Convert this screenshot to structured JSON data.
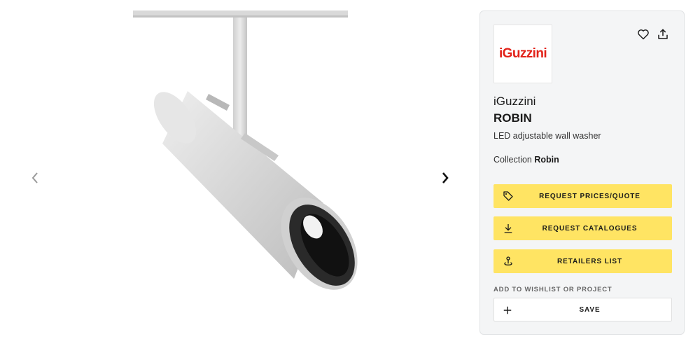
{
  "gallery": {
    "image_alt": "iGuzzini ROBIN LED adjustable wall washer",
    "prev_icon": "chevron-left-icon",
    "next_icon": "chevron-right-icon"
  },
  "card": {
    "logo_text": "iGuzzini",
    "wishlist_icon": "heart-icon",
    "share_icon": "share-icon",
    "brand": "iGuzzini",
    "product_name": "ROBIN",
    "description": "LED adjustable wall washer",
    "collection_label": "Collection",
    "collection_value": "Robin",
    "actions": {
      "quote": {
        "label": "REQUEST PRICES/QUOTE",
        "icon": "tag-icon"
      },
      "catalogues": {
        "label": "REQUEST CATALOGUES",
        "icon": "download-icon"
      },
      "retailers": {
        "label": "RETAILERS LIST",
        "icon": "location-pin-icon"
      }
    },
    "wishlist_section_label": "ADD TO WISHLIST OR PROJECT",
    "save": {
      "label": "SAVE",
      "icon": "plus-icon"
    }
  },
  "colors": {
    "cta_yellow": "#ffe463",
    "brand_red": "#e2231a",
    "card_bg": "#f4f5f6"
  }
}
